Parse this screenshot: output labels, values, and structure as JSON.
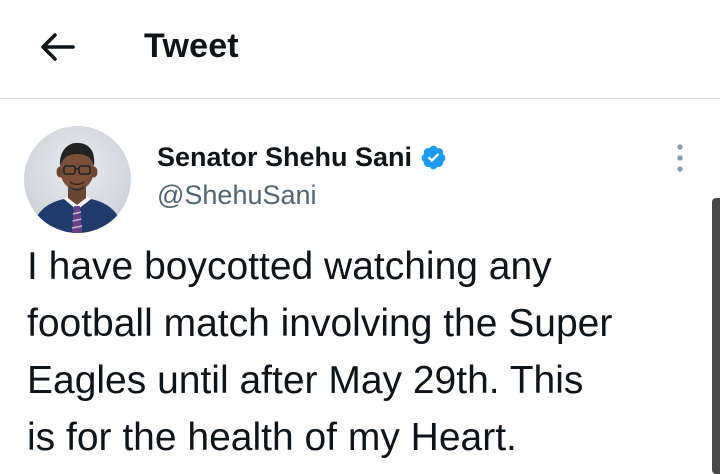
{
  "header": {
    "back_icon": "arrow-left-icon",
    "title": "Tweet"
  },
  "tweet": {
    "author": {
      "display_name": "Senator Shehu Sani",
      "handle": "@ShehuSani",
      "verified": true,
      "verified_icon": "verified-badge-icon",
      "avatar_icon": "avatar-photo"
    },
    "more_icon": "more-vertical-icon",
    "text": "I have boycotted watching any\nfootball match involving the Super\nEagles until after May 29th. This\nis for the health of my Heart."
  },
  "colors": {
    "text_primary": "#0f1419",
    "text_secondary": "#536471",
    "verified_blue": "#1d9bf0",
    "divider": "#e1e4e6",
    "scrollbar": "#4a4a4a"
  }
}
